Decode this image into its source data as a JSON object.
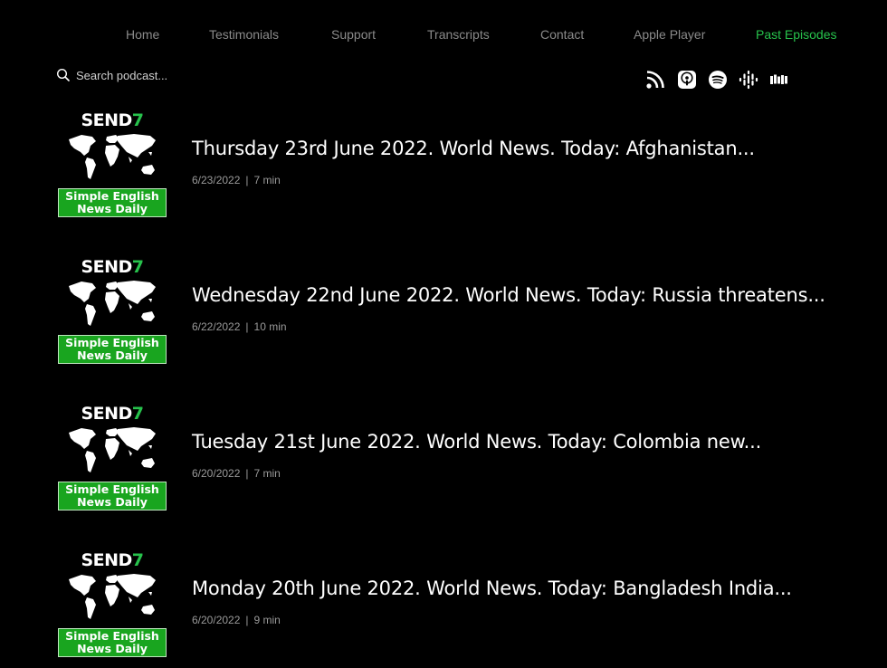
{
  "nav": {
    "items": [
      {
        "label": "Home"
      },
      {
        "label": "Testimonials"
      },
      {
        "label": "Support"
      },
      {
        "label": "Transcripts"
      },
      {
        "label": "Contact"
      },
      {
        "label": "Apple Player"
      },
      {
        "label": "Past Episodes"
      }
    ],
    "active": "Past Episodes",
    "active_color": "#27c24c"
  },
  "search": {
    "placeholder": "Search podcast..."
  },
  "social": {
    "icons": [
      "rss-icon",
      "apple-podcasts-icon",
      "spotify-icon",
      "google-podcasts-icon",
      "stitcher-icon"
    ]
  },
  "thumbnail": {
    "brand_text": "SEND",
    "brand_digit": "7",
    "badge_line1": "Simple English",
    "badge_line2": "News Daily",
    "brand_color": "#27c24c",
    "badge_color": "#19a51f"
  },
  "episodes": [
    {
      "title": "Thursday 23rd June 2022. World News. Today: Afghanistan...",
      "date": "6/23/2022",
      "duration": "7 min"
    },
    {
      "title": "Wednesday 22nd June 2022. World News. Today: Russia threatens...",
      "date": "6/22/2022",
      "duration": "10 min"
    },
    {
      "title": "Tuesday 21st June 2022. World News. Today: Colombia new...",
      "date": "6/20/2022",
      "duration": "7 min"
    },
    {
      "title": "Monday 20th June 2022. World News. Today: Bangladesh India...",
      "date": "6/20/2022",
      "duration": "9 min"
    }
  ],
  "meta_separator": "|"
}
